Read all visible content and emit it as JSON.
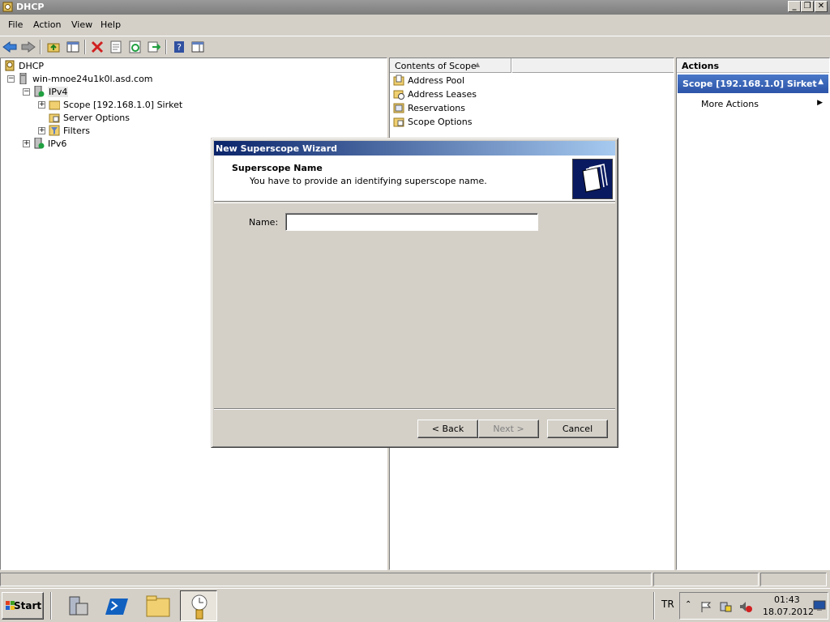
{
  "window": {
    "title": "DHCP",
    "minimize": "_",
    "restore": "❐",
    "close": "✕"
  },
  "menu": [
    "File",
    "Action",
    "View",
    "Help"
  ],
  "toolbar": [
    "back-icon",
    "forward-icon",
    "up-folder-icon",
    "show-hide-tree-icon",
    "delete-icon",
    "properties-icon",
    "refresh-icon",
    "export-icon",
    "help-icon",
    "show-hide-action-pane-icon"
  ],
  "tree": {
    "root": "DHCP",
    "server": "win-mnoe24u1k0l.asd.com",
    "ipv4": "IPv4",
    "scope": "Scope [192.168.1.0] Sirket",
    "server_options": "Server Options",
    "filters": "Filters",
    "ipv6": "IPv6"
  },
  "list": {
    "header": "Contents of Scope",
    "items": [
      "Address Pool",
      "Address Leases",
      "Reservations",
      "Scope Options"
    ]
  },
  "actions": {
    "header": "Actions",
    "section": "Scope [192.168.1.0] Sirket",
    "more": "More Actions"
  },
  "dialog": {
    "title": "New Superscope Wizard",
    "heading": "Superscope Name",
    "subheading": "You have to provide an identifying superscope name.",
    "name_label": "Name:",
    "name_value": "",
    "back": "< Back",
    "next": "Next >",
    "cancel": "Cancel"
  },
  "taskbar": {
    "start": "Start",
    "lang": "TR",
    "time": "01:43",
    "date": "18.07.2012"
  }
}
